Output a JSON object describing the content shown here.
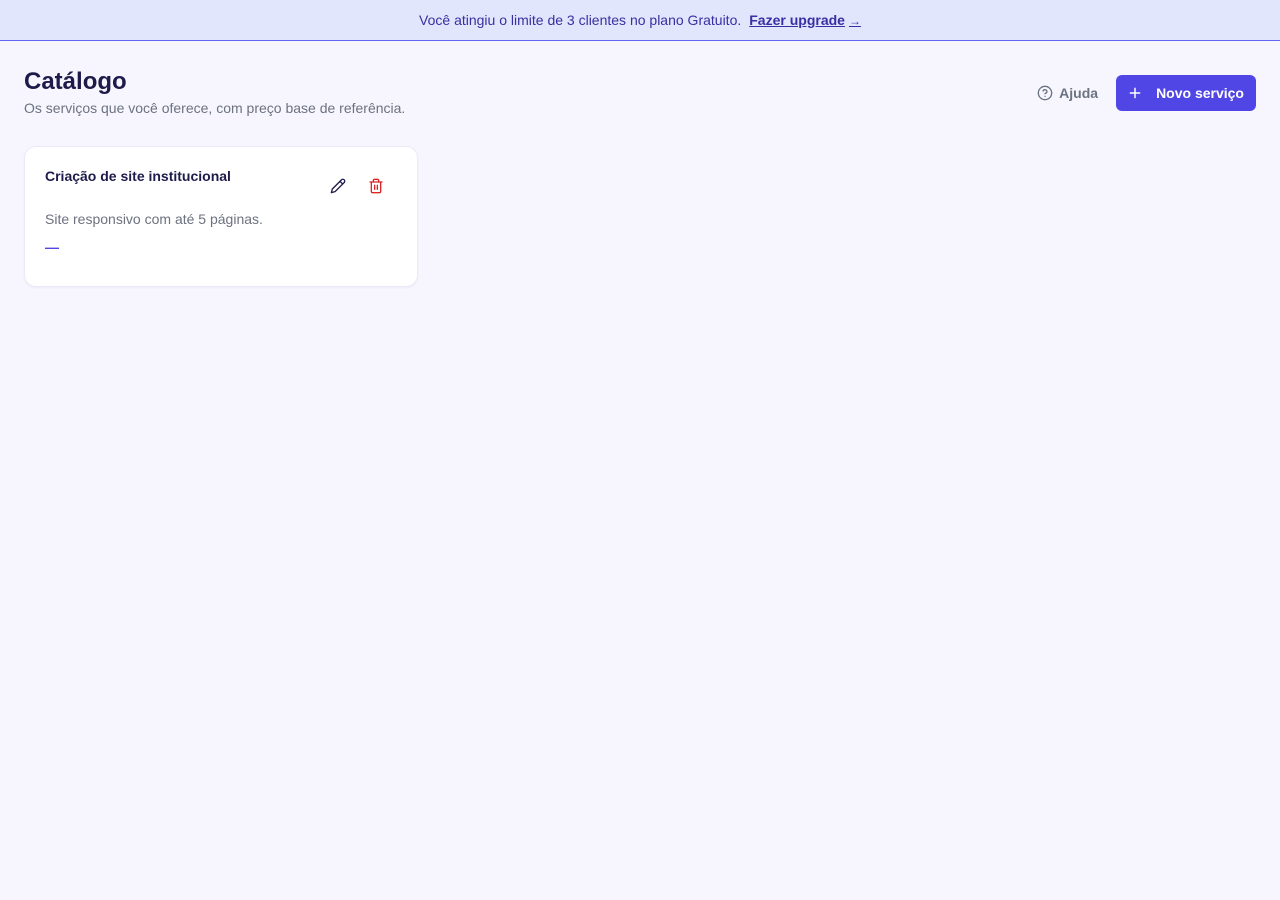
{
  "banner": {
    "message": "Você atingiu o limite de 3 clientes no plano Gratuito.",
    "link_label": "Fazer upgrade",
    "link_arrow": "→"
  },
  "page": {
    "title": "Catálogo",
    "subtitle": "Os serviços que você oferece, com preço base de referência."
  },
  "actions": {
    "help_label": "Ajuda",
    "help_icon": "help-circle-icon",
    "new_label": "Novo serviço",
    "new_icon": "plus-icon"
  },
  "services": [
    {
      "title": "Criação de site institucional",
      "description": "Site responsivo com até 5 páginas.",
      "price": "—",
      "edit_icon": "pencil-icon",
      "delete_icon": "trash-icon"
    }
  ],
  "colors": {
    "accent": "#4f46e5",
    "banner_bg": "#e2e6fd",
    "danger": "#dc2626",
    "page_bg": "#f7f6fe"
  }
}
